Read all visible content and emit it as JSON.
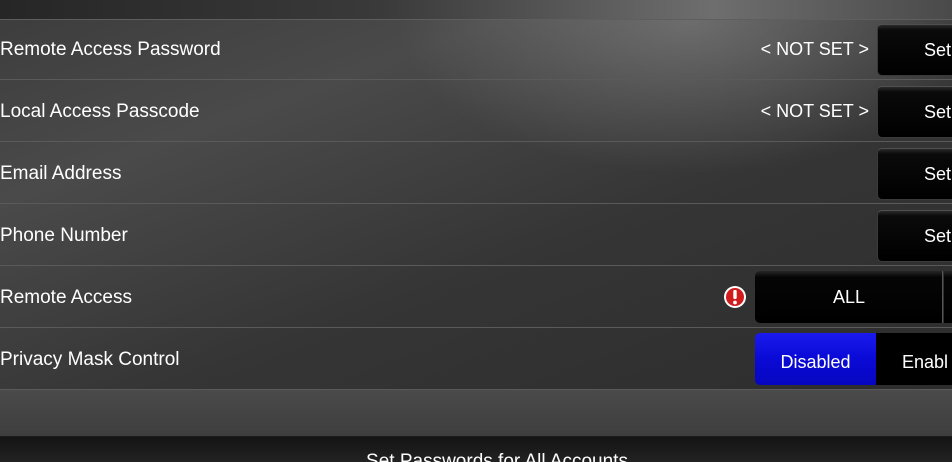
{
  "rows": [
    {
      "label": "Remote Access Password",
      "value": "< NOT SET >",
      "button": "Set"
    },
    {
      "label": "Local Access Passcode",
      "value": "< NOT SET >",
      "button": "Set"
    },
    {
      "label": "Email Address",
      "button": "Set"
    },
    {
      "label": "Phone Number",
      "button": "Set"
    }
  ],
  "remote_access": {
    "label": "Remote Access",
    "warning_icon": "exclamation-circle-icon",
    "selected_option": "ALL"
  },
  "privacy_mask": {
    "label": "Privacy Mask Control",
    "options": [
      "Disabled",
      "Enabl"
    ],
    "selected": "Disabled"
  },
  "footer_button": "Set Passwords for All Accounts",
  "colors": {
    "selected_segment": "#0a0ad6",
    "warning": "#d01c1c",
    "button": "#000000"
  }
}
